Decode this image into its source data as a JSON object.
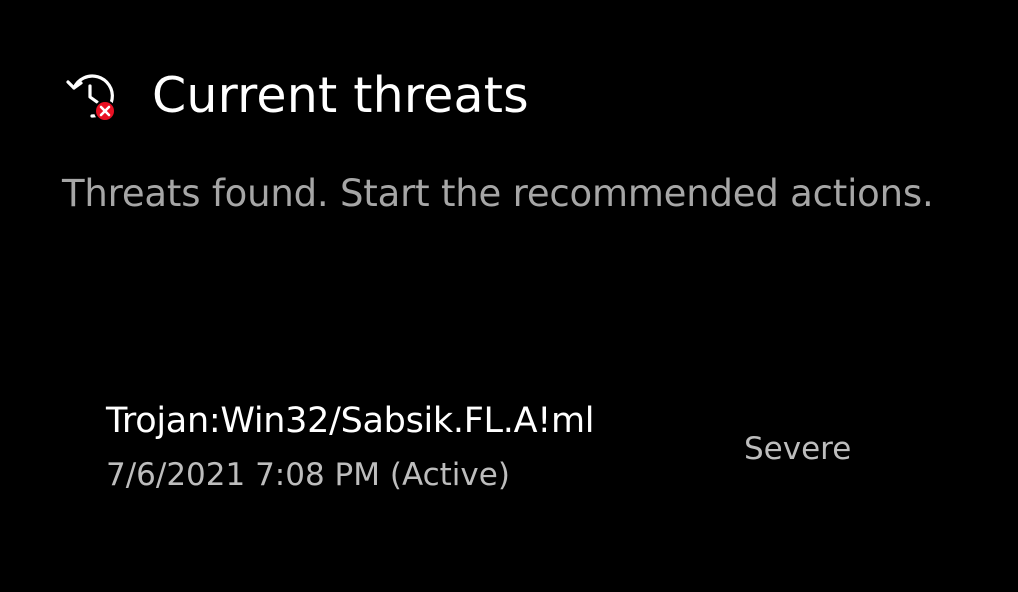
{
  "header": {
    "icon": "history-threat-icon",
    "title": "Current threats"
  },
  "description": "Threats found. Start the recommended actions.",
  "threats": [
    {
      "name": "Trojan:Win32/Sabsik.FL.A!ml",
      "date": "7/6/2021 7:08 PM (Active)",
      "severity": "Severe"
    }
  ],
  "colors": {
    "background": "#000000",
    "title": "#ffffff",
    "secondary_text": "#a6a6a6",
    "alert_badge": "#e81123"
  }
}
